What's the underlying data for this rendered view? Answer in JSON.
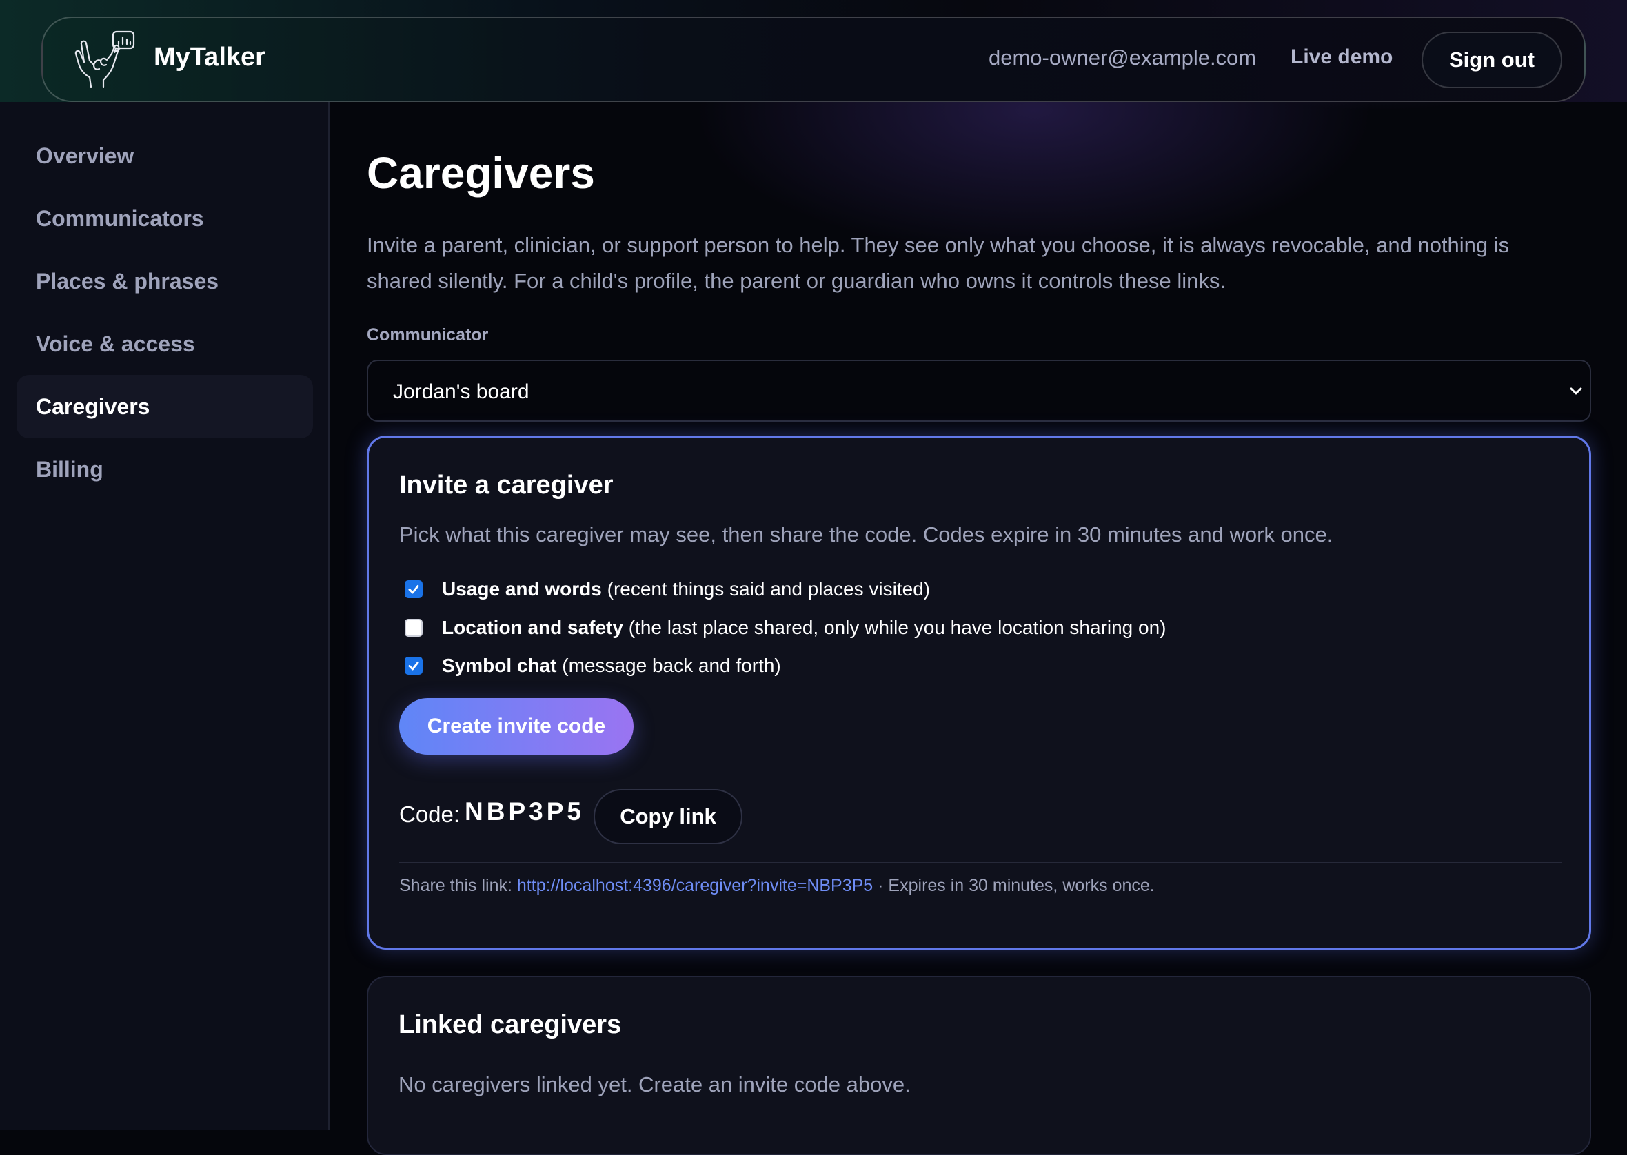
{
  "app": {
    "brand": "MyTalker",
    "user_email": "demo-owner@example.com",
    "live_demo_label": "Live demo",
    "sign_out_label": "Sign out",
    "logo_icon": "hand-rock-sign-with-chart-bubble-icon"
  },
  "sidebar": {
    "items": [
      {
        "label": "Overview",
        "active": false
      },
      {
        "label": "Communicators",
        "active": false
      },
      {
        "label": "Places & phrases",
        "active": false
      },
      {
        "label": "Voice & access",
        "active": false
      },
      {
        "label": "Caregivers",
        "active": true
      },
      {
        "label": "Billing",
        "active": false
      }
    ]
  },
  "page": {
    "title": "Caregivers",
    "intro": "Invite a parent, clinician, or support person to help. They see only what you choose, it is always revocable, and nothing is shared silently. For a child's profile, the parent or guardian who owns it controls these links.",
    "communicator_label": "Communicator",
    "communicator_selected": "Jordan's board"
  },
  "invite": {
    "title": "Invite a caregiver",
    "subtitle": "Pick what this caregiver may see, then share the code. Codes expire in 30 minutes and work once.",
    "options": [
      {
        "bold": "Usage and words",
        "detail": " (recent things said and places visited)",
        "checked": true
      },
      {
        "bold": "Location and safety",
        "detail": " (the last place shared, only while you have location sharing on)",
        "checked": false
      },
      {
        "bold": "Symbol chat",
        "detail": " (message back and forth)",
        "checked": true
      }
    ],
    "create_label": "Create invite code",
    "code_label": "Code:",
    "code_value": "NBP3P5",
    "copy_label": "Copy link",
    "share_prefix": "Share this link: ",
    "share_url": "http://localhost:4396/caregiver?invite=NBP3P5",
    "share_suffix": " · Expires in 30 minutes, works once."
  },
  "linked": {
    "title": "Linked caregivers",
    "empty_text": "No caregivers linked yet. Create an invite code above."
  },
  "colors": {
    "accent": "#6178e8",
    "button_gradient_start": "#5f86f7",
    "button_gradient_end": "#9a74f1",
    "link": "#6f8df5",
    "checkbox": "#1a73e8"
  }
}
